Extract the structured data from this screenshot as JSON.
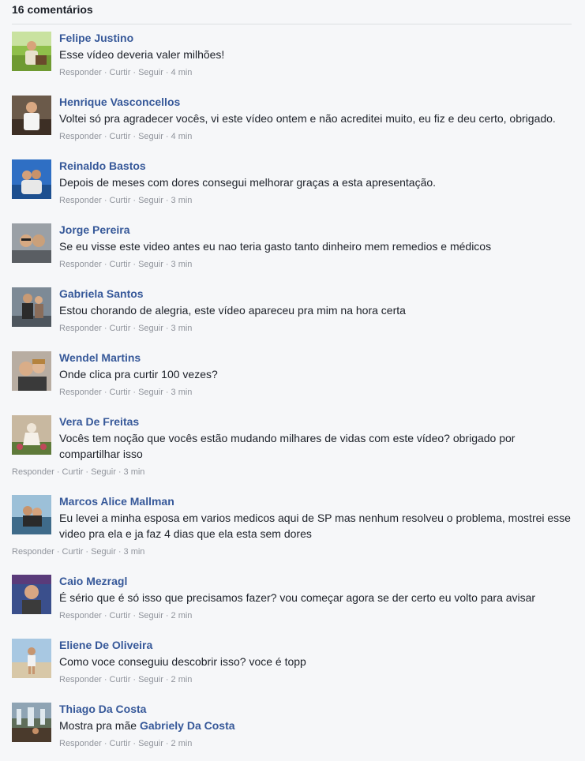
{
  "header": {
    "count_label": "16 comentários"
  },
  "actions": {
    "reply": "Responder",
    "like": "Curtir",
    "follow": "Seguir",
    "separator": "·"
  },
  "comments": [
    {
      "name": "Felipe Justino",
      "text": "Esse vídeo deveria valer milhões!",
      "time": "4 min",
      "avatar_icon": "user-photo-icon"
    },
    {
      "name": "Henrique Vasconcellos",
      "text": "Voltei só pra agradecer vocês, vi este vídeo ontem e não acreditei muito, eu fiz e deu certo, obrigado.",
      "time": "4 min",
      "avatar_icon": "user-photo-icon"
    },
    {
      "name": "Reinaldo Bastos",
      "text": "Depois de meses com dores consegui melhorar graças a esta apresentação.",
      "time": "3 min",
      "avatar_icon": "user-photo-icon"
    },
    {
      "name": "Jorge Pereira",
      "text": "Se eu visse este video antes eu nao teria gasto tanto dinheiro mem remedios e médicos",
      "time": "3 min",
      "avatar_icon": "user-photo-icon"
    },
    {
      "name": "Gabriela Santos",
      "text": "Estou chorando de alegria, este vídeo apareceu pra mim na hora certa",
      "time": "3 min",
      "avatar_icon": "user-photo-icon"
    },
    {
      "name": "Wendel Martins",
      "text": "Onde clica pra curtir 100 vezes?",
      "time": "3 min",
      "avatar_icon": "user-photo-icon"
    },
    {
      "name": "Vera De Freitas",
      "text": "Vocês tem noção que vocês estão mudando milhares de vidas com este vídeo? obrigado por compartilhar isso",
      "time": "3 min",
      "avatar_icon": "user-photo-icon"
    },
    {
      "name": "Marcos Alice Mallman",
      "text": "Eu levei a minha esposa em varios medicos aqui de SP mas nenhum resolveu o problema, mostrei esse video pra ela e ja faz 4 dias que ela esta sem dores",
      "time": "3 min",
      "avatar_icon": "user-photo-icon"
    },
    {
      "name": "Caio Mezragl",
      "text": "É sério que é só isso que precisamos fazer? vou começar agora se der certo eu volto para avisar",
      "time": "2 min",
      "avatar_icon": "user-photo-icon"
    },
    {
      "name": "Eliene De Oliveira",
      "text": "Como voce conseguiu descobrir isso? voce é topp",
      "time": "2 min",
      "avatar_icon": "user-photo-icon"
    },
    {
      "name": "Thiago Da Costa",
      "text": "Mostra pra mãe ",
      "mention": "Gabriely Da Costa",
      "time": "2 min",
      "avatar_icon": "user-photo-icon"
    }
  ]
}
